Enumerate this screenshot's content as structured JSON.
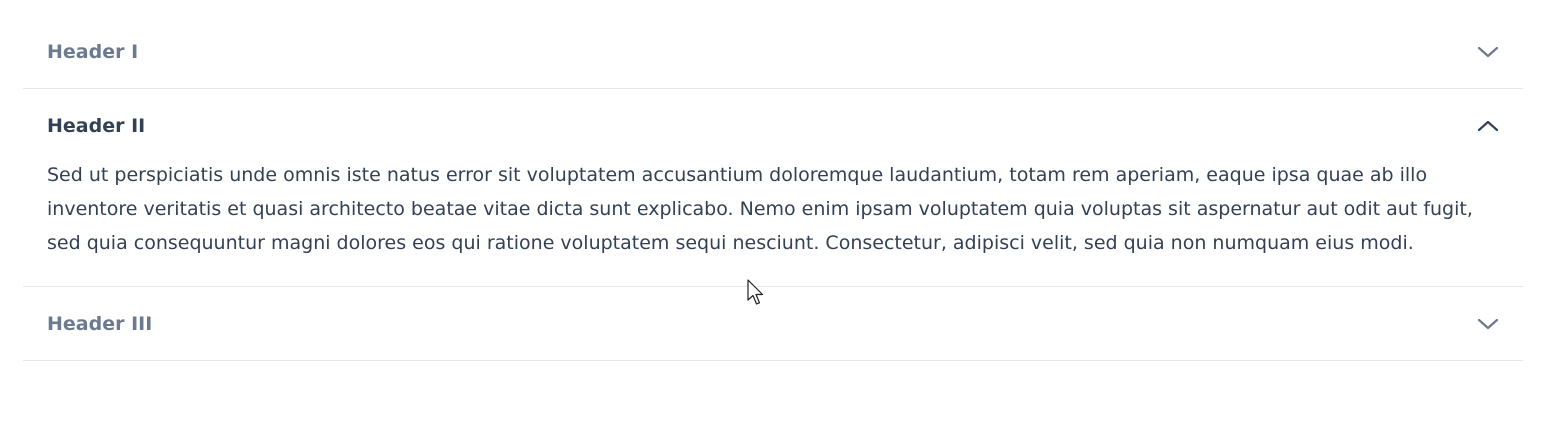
{
  "accordion": {
    "items": [
      {
        "title": "Header I",
        "expanded": false,
        "icon": "chevron-down-icon"
      },
      {
        "title": "Header II",
        "expanded": true,
        "icon": "chevron-up-icon",
        "content": "Sed ut perspiciatis unde omnis iste natus error sit voluptatem accusantium doloremque laudantium, totam rem aperiam, eaque ipsa quae ab illo inventore veritatis et quasi architecto beatae vitae dicta sunt explicabo. Nemo enim ipsam voluptatem quia voluptas sit aspernatur aut odit aut fugit, sed quia consequuntur magni dolores eos qui ratione voluptatem sequi nesciunt. Consectetur, adipisci velit, sed quia non numquam eius modi."
      },
      {
        "title": "Header III",
        "expanded": false,
        "icon": "chevron-down-icon"
      }
    ]
  },
  "colors": {
    "collapsed_title": "#6b7a8f",
    "expanded_title": "#334155",
    "body_text": "#334155",
    "divider": "#e5e7eb"
  }
}
